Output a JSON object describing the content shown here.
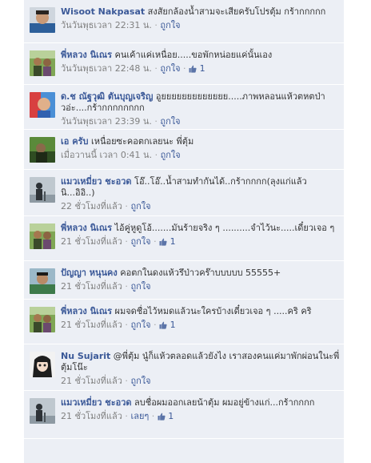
{
  "comments": [
    {
      "author": "Wisoot Nakpasat",
      "text": "สงสัยกล้องน้ำสามจะเสียครับโปรตุ้ม กร้ากกกกก",
      "time": "วันวันพุธเวลา 22:31 น.",
      "like_label": "ถูกใจ",
      "likes": "",
      "avatar": "man-blue-shirt"
    },
    {
      "author": "พี่หลวง นิเณร",
      "text": "คนเค้าแค่เหนื่อย.....ขอพักหน่อยแค่นั้นเอง",
      "time": "วันวันพุธเวลา 22:48 น.",
      "like_label": "ถูกใจ",
      "likes": "1",
      "avatar": "outdoor-group"
    },
    {
      "author": "ด.ช ณัฐวุฒิ ตันบุญเจริญ",
      "text": "อูยยยยยยยยยยยยย.....ภาพหลอนแห้วตหตป่าวอ่ะ....กร้ากกกกกกกก",
      "time": "วันวันพุธเวลา 23:39 น.",
      "like_label": "ถูกใจ",
      "likes": "",
      "avatar": "boy-red-blue"
    },
    {
      "author": "เอ ครับ",
      "text": "เหนื่อยซะคอตกเลยนะ พี่ตุ้ม",
      "time": "เมื่อวานนี้ เวลา 0:41 น.",
      "like_label": "ถูกใจ",
      "likes": "",
      "avatar": "green-dark"
    },
    {
      "author": "แมวเหมี่ยว ชะอวด",
      "text": "โอ๊..โอ๊..น้ำสามทำกันได้..กร้ากกกก(ลุงแก่แล้วนิ...อิอิ..)",
      "time": "22 ชั่วโมงที่แล้ว",
      "like_label": "ถูกใจ",
      "likes": "",
      "avatar": "silhouette-outdoor"
    },
    {
      "author": "พี่หลวง นิเณร",
      "text": "ไอ้คู่หูดูโอ้.......มันร้ายจริง ๆ ..........จำไว้นะ.....เดี๋ยวเจอ ๆ",
      "time": "21 ชั่วโมงที่แล้ว",
      "like_label": "ถูกใจ",
      "likes": "1",
      "avatar": "outdoor-group"
    },
    {
      "author": "ปัญญา หนุนคง",
      "text": "คอตกในดงแห้วรึป่าวคร๊าบบบบบ 55555+",
      "time": "21 ชั่วโมงที่แล้ว",
      "like_label": "ถูกใจ",
      "likes": "",
      "avatar": "man-green"
    },
    {
      "author": "พี่หลวง นิเณร",
      "text": "ผมจดชื่อไว้หมดแล้วนะใครบ้างเดี๋ยวเจอ ๆ .....คริ คริ",
      "time": "21 ชั่วโมงที่แล้ว",
      "like_label": "ถูกใจ",
      "likes": "1",
      "avatar": "outdoor-group"
    },
    {
      "author": "Nu Sujarit",
      "text": "@พี่ตุ้ม นู๋ก็แห้วตลอดแล้วยังไง เราสองคนแค่มาพักผ่อนในะพี่ตุ้มโน๊ะ",
      "time": "21 ชั่วโมงที่แล้ว",
      "like_label": "ถูกใจ",
      "likes": "",
      "avatar": "anime-girl"
    },
    {
      "author": "แมวเหมี่ยว ชะอวด",
      "text": "ลบชื่อผมออกเลยน้าตุ้ม ผมอยู่ข้างแก่...กร้ากกกก",
      "time": "21 ชั่วโมงที่แล้ว",
      "like_label": "เลยๆ",
      "likes": "1",
      "avatar": "silhouette-outdoor"
    }
  ],
  "colors": {
    "panel_bg": "#eceff5",
    "author": "#3b5998",
    "meta": "#808080",
    "text": "#333333"
  }
}
